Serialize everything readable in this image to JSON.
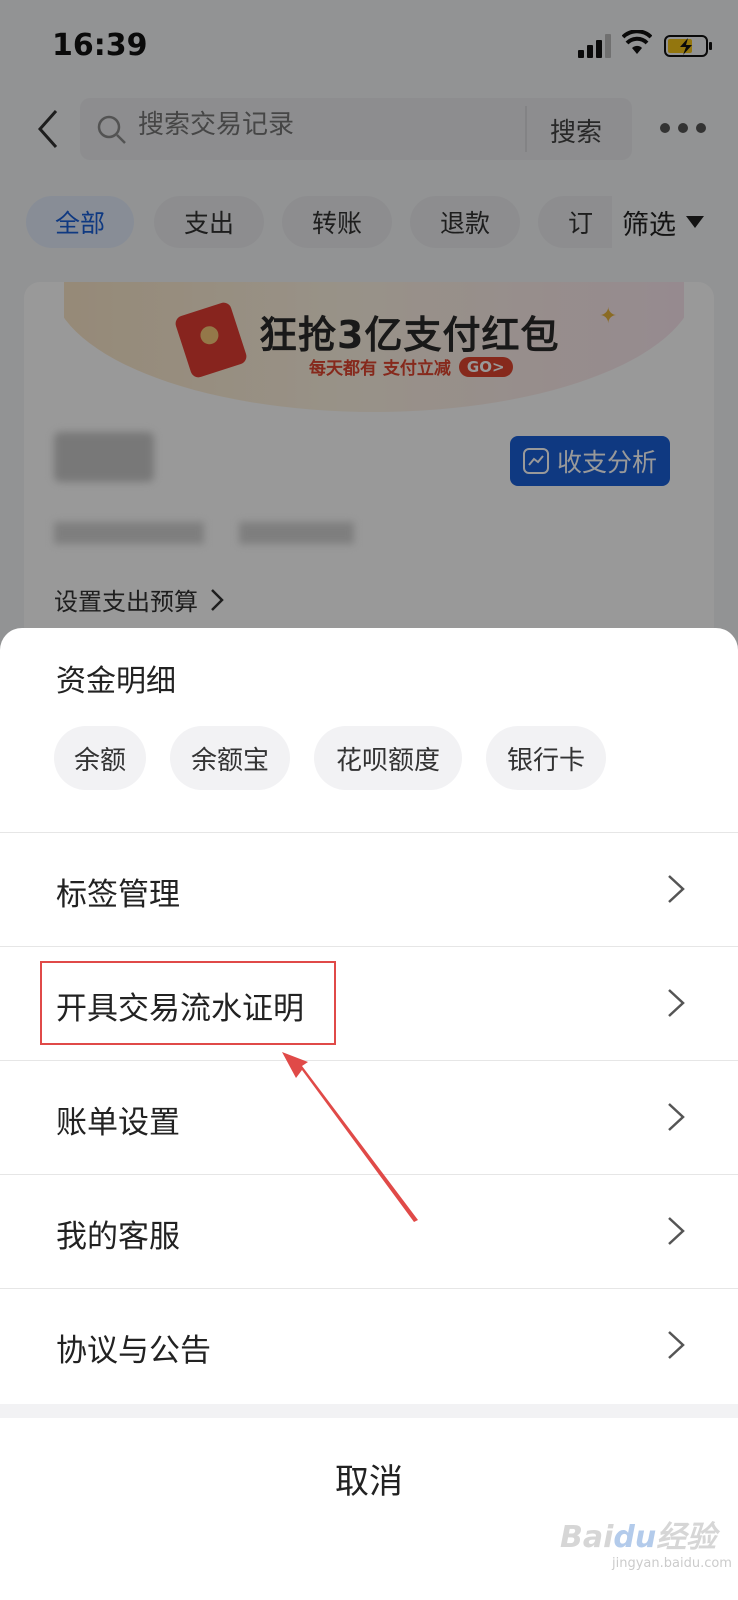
{
  "status_bar": {
    "time": "16:39"
  },
  "header": {
    "search_placeholder": "搜索交易记录",
    "search_button": "搜索"
  },
  "filter_tabs": {
    "items": [
      "全部",
      "支出",
      "转账",
      "退款",
      "订"
    ],
    "active": "全部",
    "filter_label": "筛选"
  },
  "banner": {
    "title": "狂抢3亿支付红包",
    "subtitle": "每天都有 支付立减",
    "badge": "GO>"
  },
  "summary": {
    "analysis_button": "收支分析",
    "budget_link": "设置支出预算"
  },
  "sheet": {
    "title": "资金明细",
    "fund_chips": [
      "余额",
      "余额宝",
      "花呗额度",
      "银行卡"
    ],
    "menu": [
      {
        "label": "标签管理"
      },
      {
        "label": "开具交易流水证明"
      },
      {
        "label": "账单设置"
      },
      {
        "label": "我的客服"
      },
      {
        "label": "协议与公告"
      }
    ],
    "cancel": "取消"
  },
  "colors": {
    "accent": "#1a5fd8",
    "annotation": "#e04a48"
  },
  "watermark": {
    "brand": "Baidu经验",
    "url": "jingyan.baidu.com"
  }
}
